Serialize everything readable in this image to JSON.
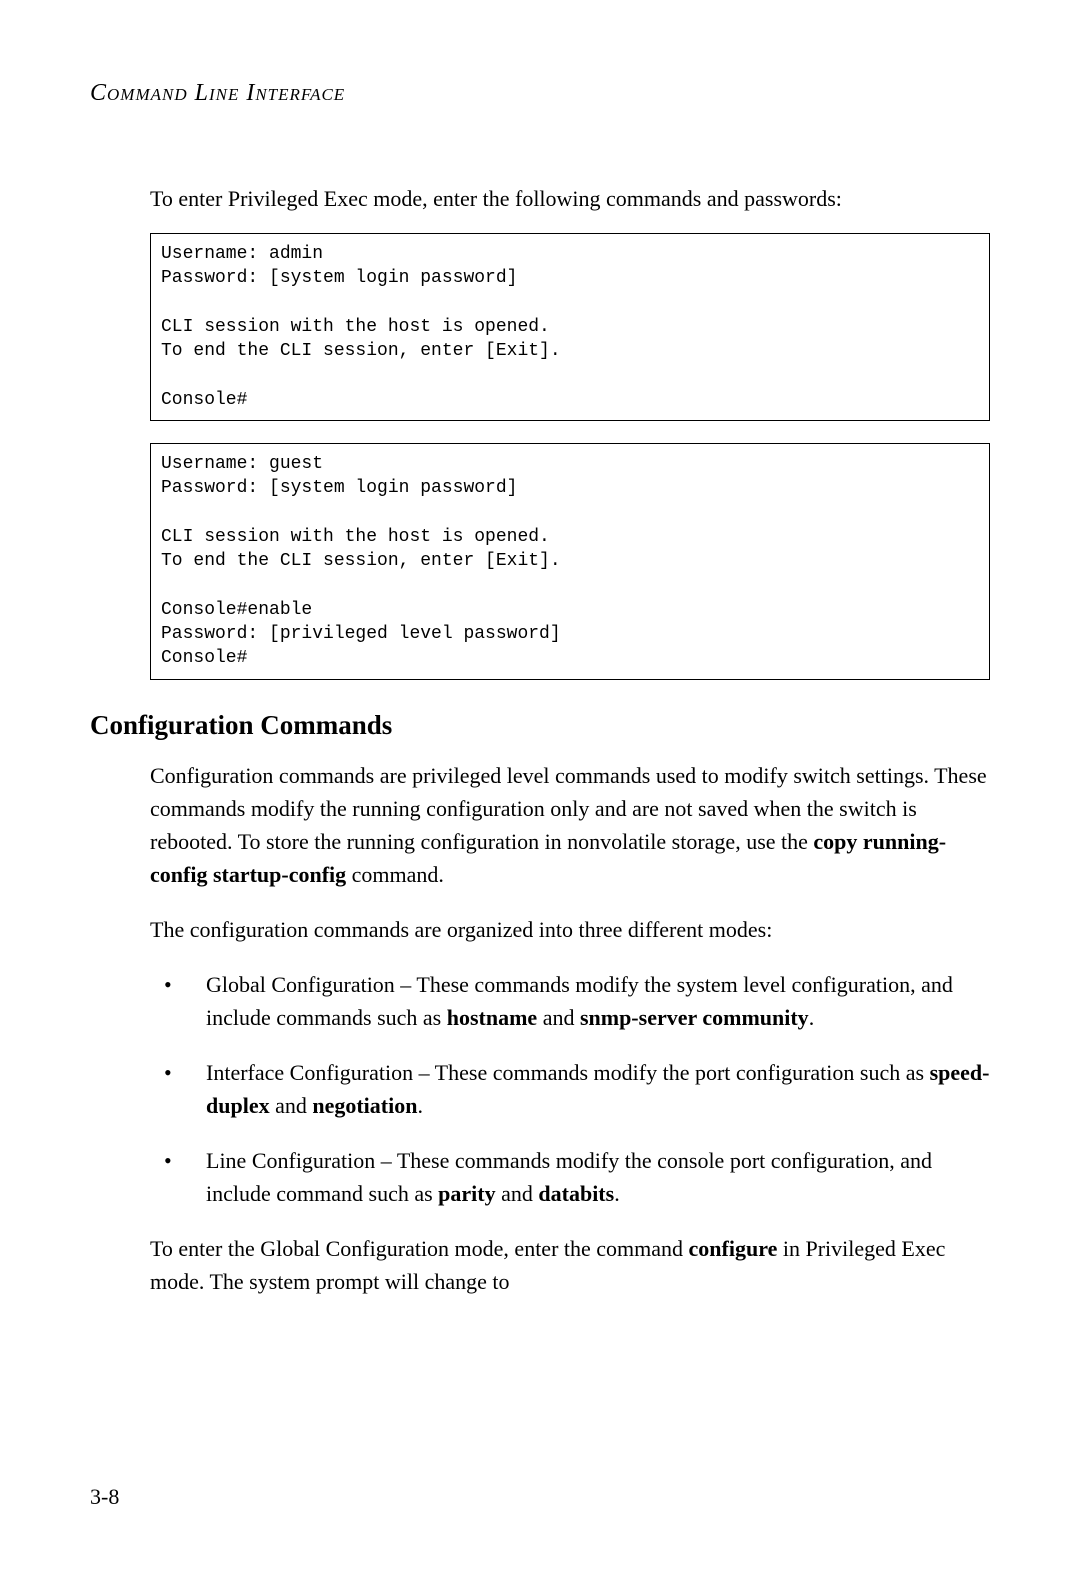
{
  "header": {
    "title": "Command Line Interface"
  },
  "intro": "To enter Privileged Exec mode, enter the following commands and passwords:",
  "codebox1": "Username: admin\nPassword: [system login password]\n\nCLI session with the host is opened.\nTo end the CLI session, enter [Exit].\n\nConsole#",
  "codebox2": "Username: guest\nPassword: [system login password]\n\nCLI session with the host is opened.\nTo end the CLI session, enter [Exit].\n\nConsole#enable\nPassword: [privileged level password]\nConsole#",
  "section": {
    "heading": "Configuration Commands",
    "para1_pre": "Configuration commands are privileged level commands used to modify switch settings. These commands modify the running configuration only and are not saved when the switch is rebooted. To store the running configuration in nonvolatile storage, use the ",
    "para1_bold": "copy running-config startup-config",
    "para1_post": " command.",
    "para2": "The configuration commands are organized into three different modes:",
    "bullets": {
      "b1_pre": "Global Configuration – These commands modify the system level configuration, and include commands such as ",
      "b1_bold1": "hostname",
      "b1_mid": " and ",
      "b1_bold2": "snmp-server community",
      "b1_post": ".",
      "b2_pre": "Interface Configuration – These commands modify the port configuration such as ",
      "b2_bold1": "speed-duplex",
      "b2_mid": " and ",
      "b2_bold2": "negotiation",
      "b2_post": ".",
      "b3_pre": "Line Configuration – These commands modify the console port configuration, and include command such as ",
      "b3_bold1": "parity",
      "b3_mid": " and ",
      "b3_bold2": "databits",
      "b3_post": "."
    },
    "para3_pre": "To enter the Global Configuration mode, enter the command ",
    "para3_bold": "configure",
    "para3_post": " in Privileged Exec mode. The system prompt will change to"
  },
  "page_number": "3-8"
}
